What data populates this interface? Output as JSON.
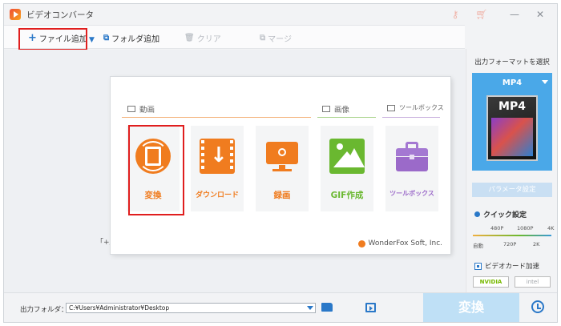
{
  "app": {
    "title": "ビデオコンバータ"
  },
  "toolbar": {
    "add_file": "ファイル追加",
    "add_folder": "フォルダ追加",
    "clear": "クリア",
    "merge": "マージ"
  },
  "droparea": {
    "hint_fragment": "「+」"
  },
  "card": {
    "sections": {
      "video": "動画",
      "image": "画像",
      "toolbox": "ツールボックス"
    },
    "tiles": [
      {
        "label": "変換"
      },
      {
        "label": "ダウンロード"
      },
      {
        "label": "録画"
      },
      {
        "label": "GIF作成"
      },
      {
        "label": "ツールボックス"
      }
    ],
    "brand": "WonderFox Soft, Inc."
  },
  "right_panel": {
    "title": "出力フォーマットを選択",
    "format": "MP4",
    "thumb_text": "MP4",
    "param_button": "パラメータ設定",
    "quick_setting": "クイック設定",
    "slider_top": [
      "480P",
      "1080P",
      "4K"
    ],
    "slider_bottom": [
      "自動",
      "720P",
      "2K"
    ],
    "gpu_accel": "ビデオカード加速",
    "vendors": [
      "NVIDIA",
      "intel"
    ]
  },
  "bottom": {
    "output_folder_label": "出力フォルダ：",
    "output_path": "C:¥Users¥Administrator¥Desktop",
    "convert_button": "変換"
  },
  "colors": {
    "accent_blue": "#2a78c8",
    "highlight_red": "#e01e1e",
    "orange": "#f07c1f",
    "green": "#6ab830",
    "purple": "#9b6ac9"
  }
}
